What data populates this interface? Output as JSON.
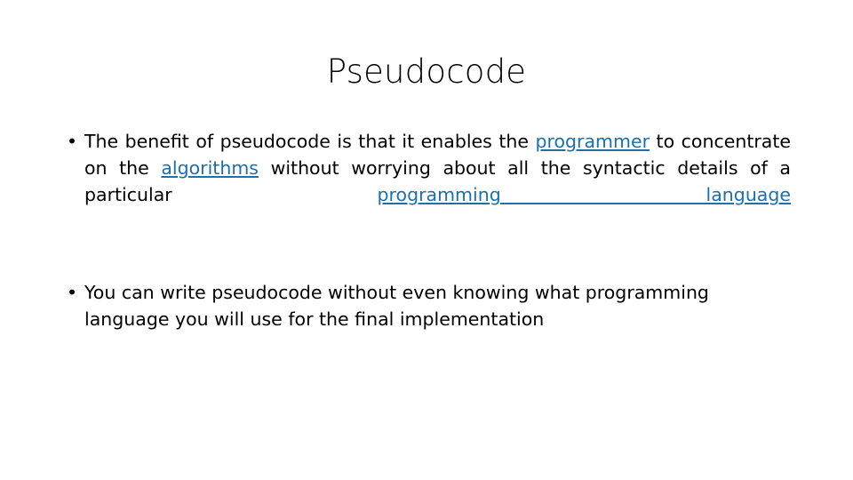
{
  "slide": {
    "title": "Pseudocode",
    "background_color": "#FFFFFF",
    "text_color": "#000000",
    "link_color": "#1F6FA8",
    "bullet_glyph": "•"
  },
  "bullets": [
    {
      "id": "bullet-1",
      "alignment": "justify",
      "marker": "•",
      "segments": [
        {
          "type": "text",
          "value": "The benefit of pseudocode is that it enables the "
        },
        {
          "type": "link",
          "value": "programmer"
        },
        {
          "type": "text",
          "value": " to concentrate on the "
        },
        {
          "type": "link",
          "value": "algorithms"
        },
        {
          "type": "text",
          "value": " without worrying about all the syntactic details of a particular "
        },
        {
          "type": "link",
          "value": "programming language"
        }
      ],
      "plain_text": "The benefit of pseudocode is that it enables the programmer to concentrate on the algorithms without worrying about all the syntactic details of a particular programming language"
    },
    {
      "id": "bullet-2",
      "alignment": "left",
      "marker": "•",
      "segments": [
        {
          "type": "text",
          "value": "You can write pseudocode without even knowing what programming language you will use for the final implementation"
        }
      ],
      "plain_text": "You can write pseudocode without even knowing what programming language you will use for the final implementation"
    }
  ]
}
